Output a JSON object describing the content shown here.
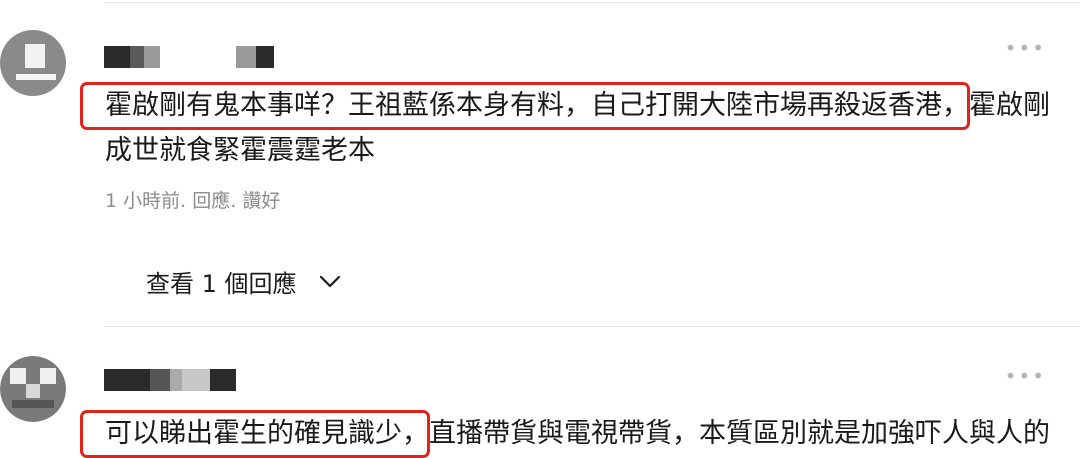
{
  "comments": [
    {
      "line1_highlighted": "霍啟剛有鬼本事咩？王祖藍係本身有料，自己打開大陸市場再殺返香港",
      "line1_rest": "，霍啟剛",
      "line2": "成世就食緊霍震霆老本",
      "time": "1 小時前",
      "sep1": ".",
      "reply": "回應",
      "sep2": ".",
      "like": "讚好",
      "view_replies": "查看 1 個回應"
    },
    {
      "line1_highlighted": "可以睇出霍生的確見識少，",
      "line1_rest": "直播帶貨與電視帶貨，本質區別就是加強吓人與人的"
    }
  ],
  "icons": {
    "more": "more-dots-icon",
    "chevron": "chevron-down-icon",
    "avatar": "avatar"
  },
  "colors": {
    "highlight_border": "#e0241b",
    "meta_text": "#8c8c8c",
    "divider": "#e6e6e6"
  }
}
